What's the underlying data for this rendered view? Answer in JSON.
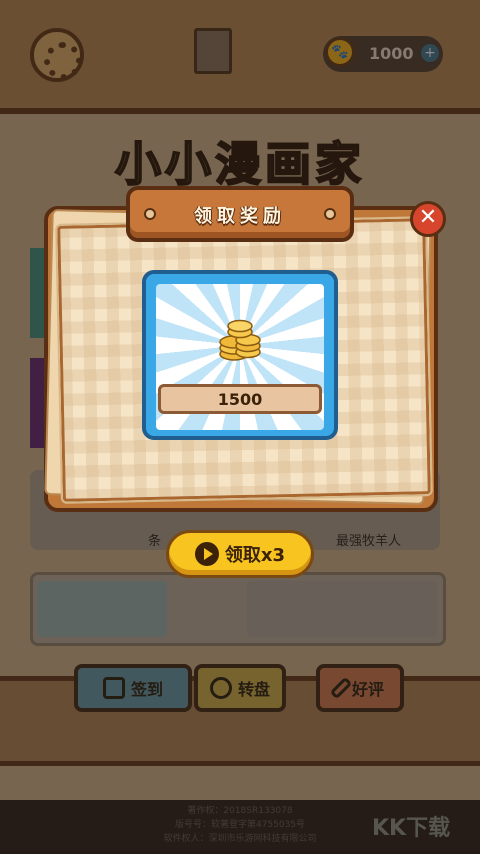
{
  "hud": {
    "coin_balance": "1000",
    "add_symbol": "+"
  },
  "game": {
    "title": "小小漫画家"
  },
  "background_cards": {
    "label_left": "条",
    "label_right": "最强牧羊人"
  },
  "bottom_nav": [
    {
      "label": "签到",
      "icon": "calendar-check-icon"
    },
    {
      "label": "转盘",
      "icon": "wheel-icon"
    },
    {
      "label": "好评",
      "icon": "pencil-icon"
    }
  ],
  "footer": {
    "lines": [
      "著作权：2018SR133078",
      "版号号：软著登字第4755035号",
      "软件权人：深圳市乐游网科技有限公司"
    ]
  },
  "watermark": "KK下载",
  "dialog": {
    "title": "领取奖励",
    "close_symbol": "✕",
    "reward_amount": "1500",
    "reward_icon": "gold-coins-icon",
    "claim_button_label": "领取x3",
    "claim_icon": "play-icon"
  },
  "colors": {
    "accent_yellow": "#f7c420",
    "close_red": "#d8452d",
    "card_blue": "#3aa8e6"
  }
}
